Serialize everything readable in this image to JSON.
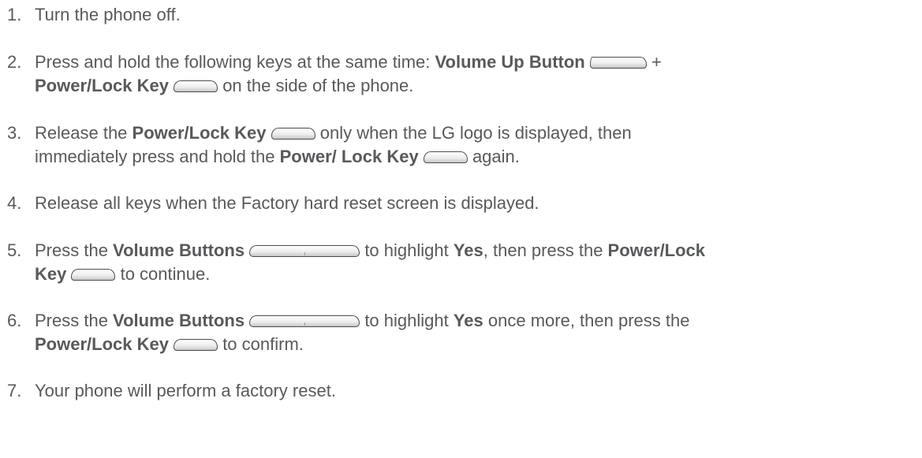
{
  "colors": {
    "text": "#58595b",
    "key_outline": "#4d4d4d"
  },
  "steps": [
    {
      "number": "1.",
      "text": "Turn the phone off."
    },
    {
      "number": "2.",
      "pre": "Press and hold the following keys at the same time: ",
      "key1": "Volume Up Button",
      "plus": " +",
      "key2": "Power/Lock Key",
      "post": " on the side of the phone.",
      "icons": [
        "volume-up-button-icon",
        "power-lock-key-icon"
      ]
    },
    {
      "number": "3.",
      "pre": "Release the ",
      "key1": "Power/Lock Key",
      "mid": " only when the LG logo is displayed, then",
      "pre2": "immediately press and hold the ",
      "key2": "Power/ Lock Key",
      "post": " again.",
      "icons": [
        "power-lock-key-icon",
        "power-lock-key-icon"
      ]
    },
    {
      "number": "4.",
      "text": "Release all keys when the Factory hard reset screen is displayed."
    },
    {
      "number": "5.",
      "pre": "Press the ",
      "key1": "Volume Buttons",
      "mid": " to highlight ",
      "option": "Yes",
      "mid2": ", then press the ",
      "key2a": "Power/Lock",
      "key2b": "Key",
      "post": " to continue.",
      "icons": [
        "volume-buttons-icon",
        "power-lock-key-icon"
      ]
    },
    {
      "number": "6.",
      "pre": "Press the ",
      "key1": "Volume Buttons",
      "mid": " to highlight ",
      "option": "Yes",
      "mid2": " once more, then press the",
      "key2": "Power/Lock Key",
      "post": " to confirm.",
      "icons": [
        "volume-buttons-icon",
        "power-lock-key-icon"
      ]
    },
    {
      "number": "7.",
      "text": "Your phone will perform a factory reset."
    }
  ]
}
